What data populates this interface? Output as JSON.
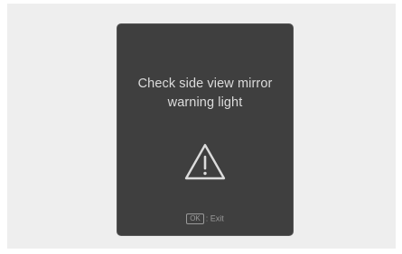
{
  "popup": {
    "message_line1": "Check side view mirror",
    "message_line2": "warning light",
    "icon": "warning-triangle-icon",
    "footer": {
      "ok_key_label": "OK",
      "exit_label": ": Exit"
    }
  },
  "colors": {
    "screen_background": "#eeeeee",
    "popup_background": "#3f3f3f",
    "text": "#dcdcdc",
    "footer_text": "#9a9a9a"
  }
}
